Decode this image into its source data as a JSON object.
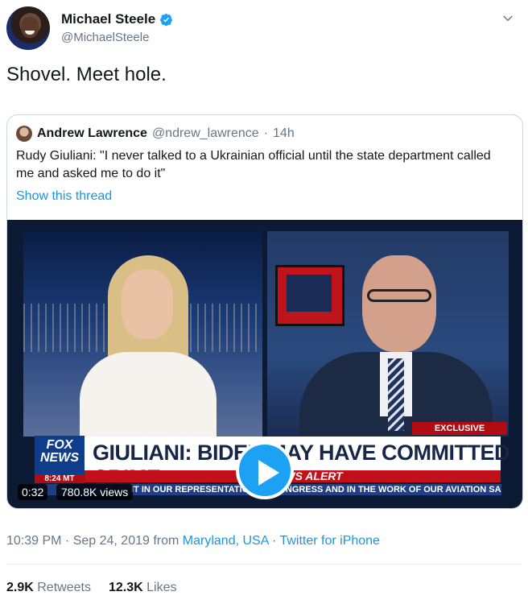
{
  "author": {
    "display_name": "Michael Steele",
    "handle": "@MichaelSteele",
    "verified": true
  },
  "tweet": {
    "text": "Shovel. Meet hole."
  },
  "quoted_tweet": {
    "display_name": "Andrew Lawrence",
    "handle": "@ndrew_lawrence",
    "age": "14h",
    "separator": "·",
    "text": "Rudy Giuliani: \"I never talked to a Ukrainian official until the state department called me and asked me to do it\"",
    "thread_link": "Show this thread"
  },
  "video": {
    "exclusive_tag": "EXCLUSIVE",
    "logo_line1": "FOX",
    "logo_line2": "NEWS",
    "logo_time": "8:24 MT",
    "headline": "GIULIANI: BIDEN MAY HAVE COMMITTED CRIME",
    "alert": "FOX NEWS ALERT",
    "ticker": "IT IN OUR REPRESENTATION TO CONGRESS AND IN THE WORK OF OUR AVIATION SA",
    "duration": "0:32",
    "views": "780.8K views"
  },
  "meta": {
    "time": "10:39 PM · Sep 24, 2019 from ",
    "location": "Maryland, USA",
    "separator": " · ",
    "source": "Twitter for iPhone"
  },
  "stats": {
    "retweets_count": "2.9K",
    "retweets_label": "Retweets",
    "likes_count": "12.3K",
    "likes_label": "Likes"
  },
  "colors": {
    "link": "#1b95e0",
    "verified": "#1da1f2",
    "muted": "#657786"
  },
  "icons": [
    "verified-badge-icon",
    "chevron-down-icon",
    "play-icon"
  ]
}
